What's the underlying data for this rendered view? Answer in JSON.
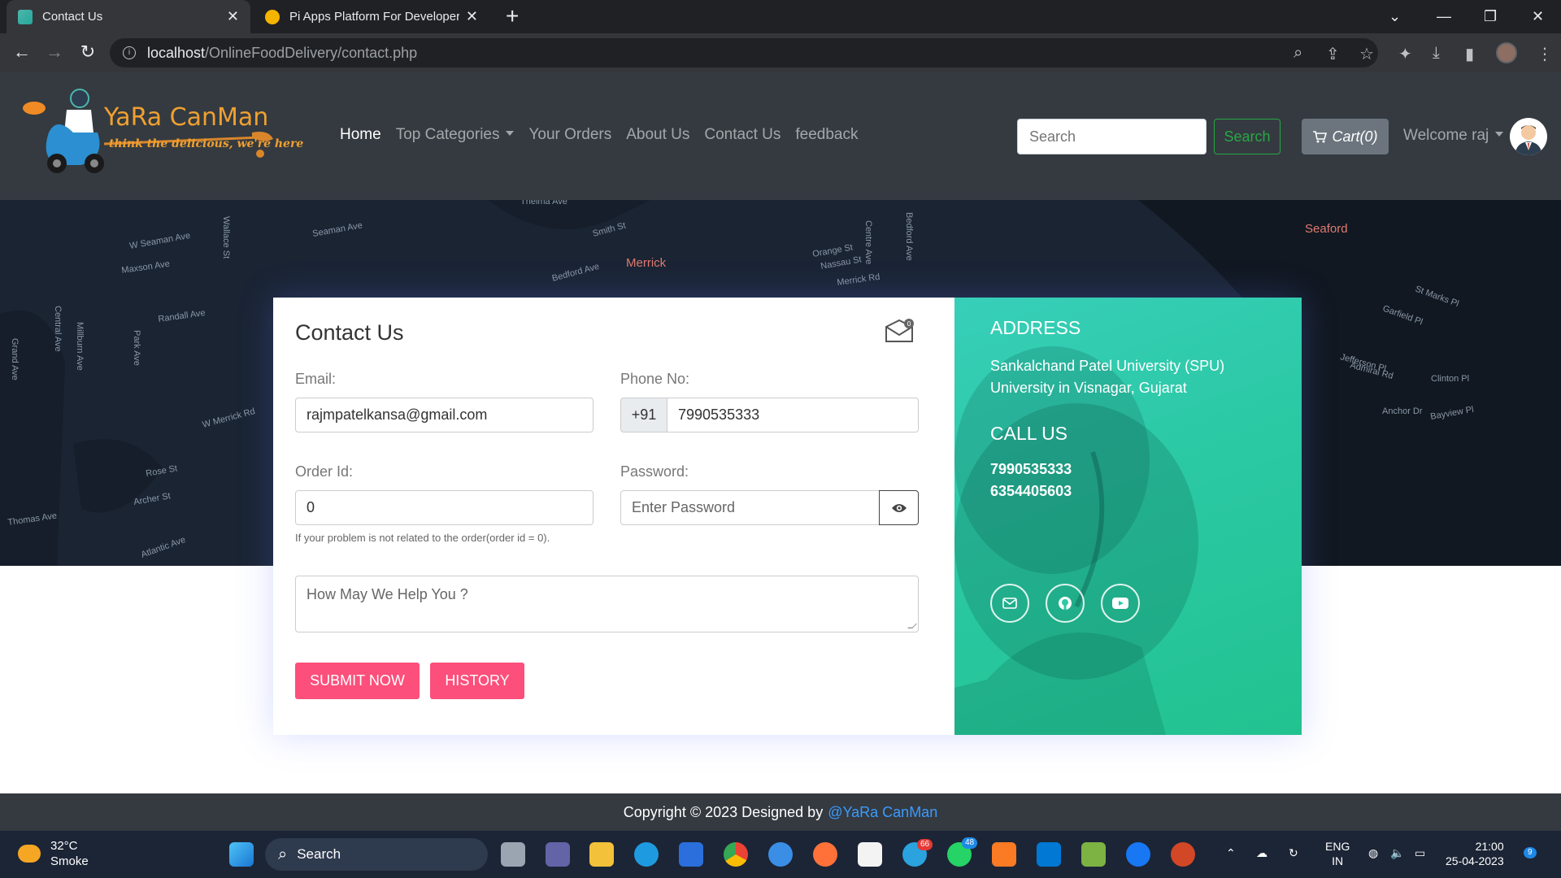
{
  "browser": {
    "tabs": [
      {
        "title": "Contact Us",
        "active": true
      },
      {
        "title": "Pi Apps Platform For Developers",
        "active": false
      }
    ],
    "url_host": "localhost",
    "url_path": "/OnlineFoodDelivery/contact.php"
  },
  "site": {
    "logo_name": "YaRa CanMan",
    "logo_tagline": "think the delicious, we're here",
    "nav": {
      "home": "Home",
      "top_categories": "Top Categories",
      "your_orders": "Your Orders",
      "about_us": "About Us",
      "contact_us": "Contact Us",
      "feedback": "feedback"
    },
    "search_placeholder": "Search",
    "search_button": "Search",
    "cart_label": "Cart(0)",
    "welcome": "Welcome raj"
  },
  "map_labels": [
    "W Seaman Ave",
    "Maxson Ave",
    "Randall Ave",
    "Merrick",
    "Seaford",
    "Merrick Rd",
    "Bedford Ave",
    "Smith St",
    "Seaman Ave",
    "Thelma Ave",
    "Orange St",
    "Nassau St",
    "W Merrick Rd",
    "Rose St",
    "Archer St",
    "Atlantic Ave",
    "Thomas Ave",
    "Park Ave",
    "Grand Ave",
    "Garfield Pl",
    "St Marks Pl",
    "Jefferson Pl",
    "Admiral Rd",
    "Clinton Pl",
    "Anchor Dr",
    "Bayview Pl",
    "Central Ave",
    "Millburn Ave",
    "Wallace St",
    "Centre Ave",
    "Bedford Ave"
  ],
  "contact_form": {
    "title": "Contact Us",
    "mail_badge": "0",
    "email_label": "Email:",
    "email_value": "rajmpatelkansa@gmail.com",
    "phone_label": "Phone No:",
    "phone_prefix": "+91",
    "phone_value": "7990535333",
    "order_label": "Order Id:",
    "order_value": "0",
    "order_hint": "If your problem is not related to the order(order id = 0).",
    "password_label": "Password:",
    "password_placeholder": "Enter Password",
    "message_placeholder": "How May We Help You ?",
    "submit_button": "SUBMIT NOW",
    "history_button": "HISTORY"
  },
  "contact_info": {
    "address_heading": "ADDRESS",
    "address_line1": "Sankalchand Patel University (SPU)",
    "address_line2": "University in Visnagar, Gujarat",
    "call_heading": "CALL US",
    "phone1": "7990535333",
    "phone2": "6354405603"
  },
  "footer": {
    "copyright": "Copyright © 2023 Designed by",
    "brand": "@YaRa CanMan"
  },
  "taskbar": {
    "temperature": "32°C",
    "weather": "Smoke",
    "search_label": "Search",
    "telegram_badge": "66",
    "whatsapp_badge": "48",
    "language": "ENG",
    "region": "IN",
    "time": "21:00",
    "date": "25-04-2023",
    "notification_count": "9"
  },
  "colors": {
    "navbar_bg": "#343a40",
    "accent_pink": "#fc4f7b",
    "info_gradient": "#2cc9a6",
    "search_green": "#28a745",
    "map_bg": "#1a2433"
  }
}
